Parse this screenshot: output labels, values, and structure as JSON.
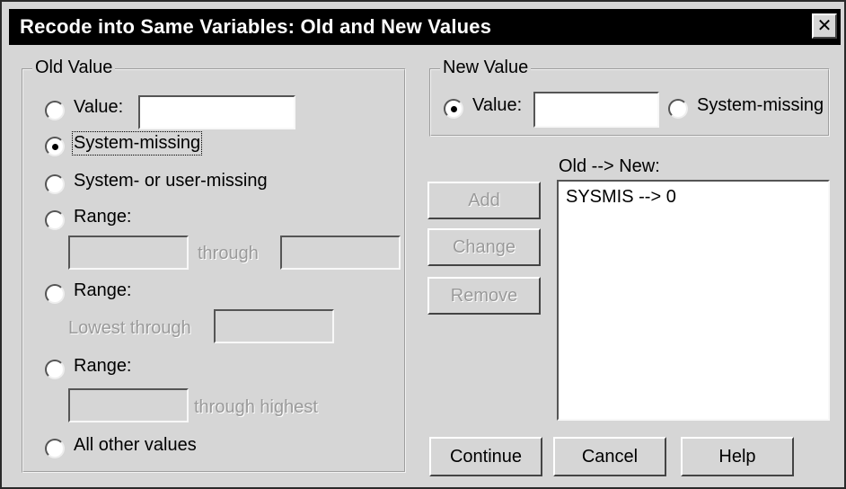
{
  "window": {
    "title": "Recode into Same Variables: Old and New Values",
    "close_label": "✕"
  },
  "old_value": {
    "legend": "Old Value",
    "value_label": "Value:",
    "system_missing_label": "System-missing",
    "system_or_user_missing_label": "System- or user-missing",
    "range_label": "Range:",
    "through_label": "through",
    "lowest_through_label": "Lowest through",
    "through_highest_label": "through highest",
    "all_other_label": "All other values",
    "selected": "System-missing"
  },
  "new_value": {
    "legend": "New Value",
    "value_label": "Value:",
    "value_input": "",
    "system_missing_label": "System-missing",
    "selected": "Value"
  },
  "mapping": {
    "label": "Old --> New:",
    "items": [
      "SYSMIS --> 0"
    ]
  },
  "buttons": {
    "add": "Add",
    "change": "Change",
    "remove": "Remove",
    "continue": "Continue",
    "cancel": "Cancel",
    "help": "Help"
  }
}
